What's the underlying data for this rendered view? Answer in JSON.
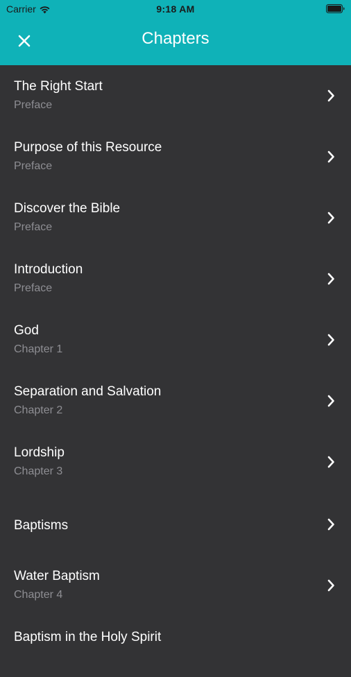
{
  "status_bar": {
    "carrier": "Carrier",
    "time": "9:18 AM"
  },
  "nav": {
    "title": "Chapters",
    "close_icon": "close-icon"
  },
  "colors": {
    "header": "#0fb2b8",
    "background": "#333335",
    "title_text": "#ffffff",
    "subtitle_text": "#8e8e93"
  },
  "chapters": [
    {
      "title": "The Right Start",
      "subtitle": "Preface"
    },
    {
      "title": "Purpose of this Resource",
      "subtitle": "Preface"
    },
    {
      "title": "Discover the Bible",
      "subtitle": "Preface"
    },
    {
      "title": "Introduction",
      "subtitle": "Preface"
    },
    {
      "title": "God",
      "subtitle": "Chapter 1"
    },
    {
      "title": "Separation and Salvation",
      "subtitle": "Chapter 2"
    },
    {
      "title": "Lordship",
      "subtitle": "Chapter 3"
    },
    {
      "title": "Baptisms",
      "subtitle": ""
    },
    {
      "title": "Water Baptism",
      "subtitle": "Chapter 4"
    },
    {
      "title": "Baptism in the Holy Spirit",
      "subtitle": ""
    }
  ]
}
